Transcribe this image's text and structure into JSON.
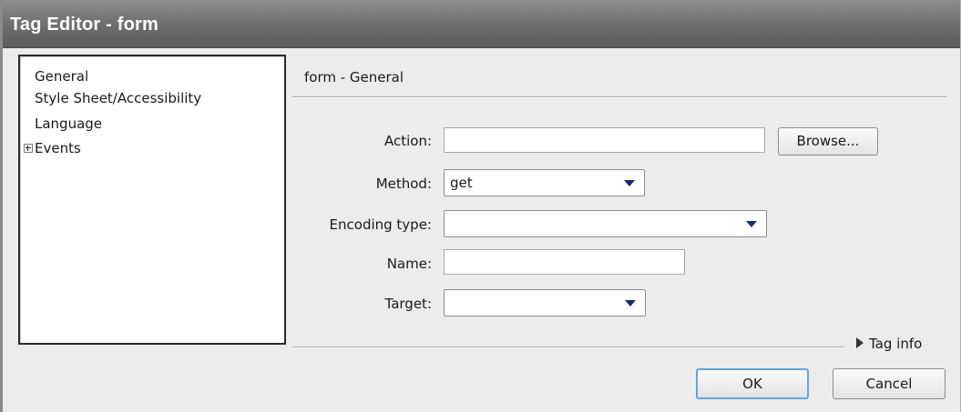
{
  "window": {
    "title": "Tag Editor - form"
  },
  "tree": {
    "items": [
      {
        "label": "General"
      },
      {
        "label": "Style Sheet/Accessibility"
      },
      {
        "label": "Language"
      },
      {
        "label": "Events",
        "expander": "plus-icon"
      }
    ]
  },
  "section": {
    "title": "form - General"
  },
  "form": {
    "action": {
      "label": "Action:",
      "value": ""
    },
    "browse_label": "Browse...",
    "method": {
      "label": "Method:",
      "value": "get"
    },
    "encoding": {
      "label": "Encoding type:",
      "value": ""
    },
    "name": {
      "label": "Name:",
      "value": ""
    },
    "target": {
      "label": "Target:",
      "value": ""
    }
  },
  "tag_info": {
    "label": "Tag info",
    "icon": "triangle-right-icon"
  },
  "buttons": {
    "ok": "OK",
    "cancel": "Cancel"
  }
}
